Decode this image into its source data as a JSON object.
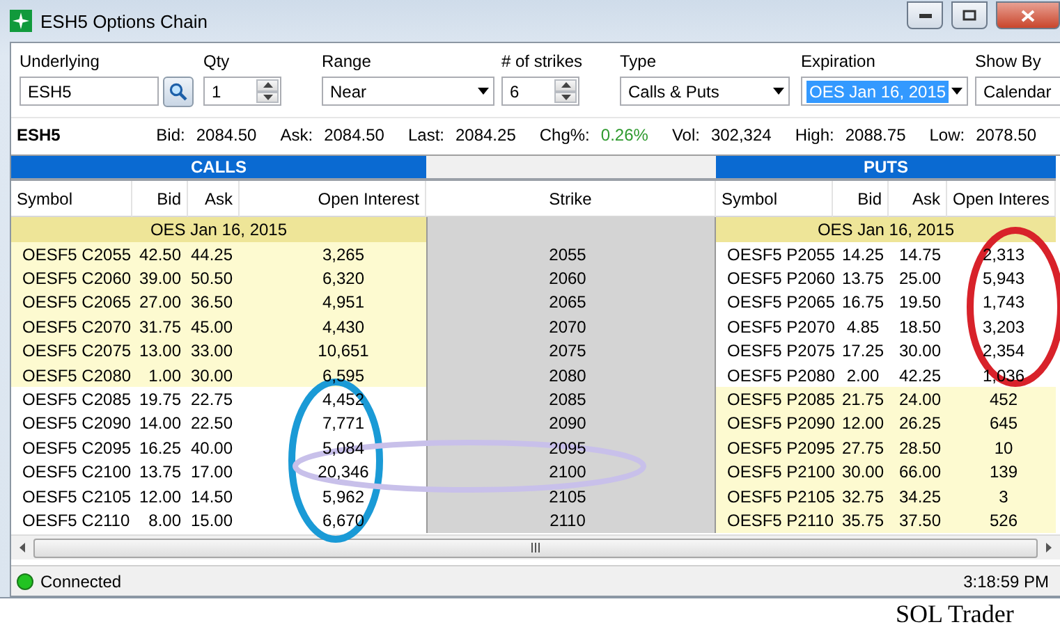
{
  "window": {
    "title": "ESH5 Options Chain"
  },
  "controls": [
    {
      "label": "Underlying",
      "kind": "lookup",
      "value": "ESH5",
      "highlighted": false
    },
    {
      "label": "Qty",
      "kind": "spinner",
      "value": "1",
      "highlighted": false
    },
    {
      "label": "Range",
      "kind": "dropdown",
      "value": "Near",
      "highlighted": false
    },
    {
      "label": "# of strikes",
      "kind": "spinner",
      "value": "6",
      "highlighted": false
    },
    {
      "label": "Type",
      "kind": "dropdown",
      "value": "Calls & Puts",
      "highlighted": false
    },
    {
      "label": "Expiration",
      "kind": "dropdown",
      "value": "OES Jan 16, 2015",
      "highlighted": true
    },
    {
      "label": "Show By",
      "kind": "dropdown",
      "value": "Calendar",
      "highlighted": false
    }
  ],
  "quote": {
    "symbol": "ESH5",
    "fields": [
      {
        "label": "Bid:",
        "value": "2084.50",
        "color": "#000000"
      },
      {
        "label": "Ask:",
        "value": "2084.50",
        "color": "#000000"
      },
      {
        "label": "Last:",
        "value": "2084.25",
        "color": "#000000"
      },
      {
        "label": "Chg%:",
        "value": "0.26%",
        "color": "#2e9a2e"
      },
      {
        "label": "Vol:",
        "value": "302,324",
        "color": "#000000"
      },
      {
        "label": "High:",
        "value": "2088.75",
        "color": "#000000"
      },
      {
        "label": "Low:",
        "value": "2078.50",
        "color": "#000000"
      }
    ]
  },
  "chain": {
    "calls_title": "CALLS",
    "puts_title": "PUTS",
    "call_columns": [
      "Symbol",
      "Bid",
      "Ask",
      "Open Interest"
    ],
    "strike_column": "Strike",
    "put_columns": [
      "Symbol",
      "Bid",
      "Ask",
      "Open Interes"
    ],
    "call_group": "OES Jan 16, 2015",
    "put_group": "OES Jan 16, 2015",
    "rows": [
      {
        "strike": "2055",
        "call": {
          "symbol": "OESF5 C2055",
          "bid": "42.50",
          "ask": "44.25",
          "oi": "3,265",
          "in_the_money": true
        },
        "put": {
          "symbol": "OESF5 P2055",
          "bid": "14.25",
          "ask": "14.75",
          "oi": "2,313",
          "in_the_money": false
        }
      },
      {
        "strike": "2060",
        "call": {
          "symbol": "OESF5 C2060",
          "bid": "39.00",
          "ask": "50.50",
          "oi": "6,320",
          "in_the_money": true
        },
        "put": {
          "symbol": "OESF5 P2060",
          "bid": "13.75",
          "ask": "25.00",
          "oi": "5,943",
          "in_the_money": false
        }
      },
      {
        "strike": "2065",
        "call": {
          "symbol": "OESF5 C2065",
          "bid": "27.00",
          "ask": "36.50",
          "oi": "4,951",
          "in_the_money": true
        },
        "put": {
          "symbol": "OESF5 P2065",
          "bid": "16.75",
          "ask": "19.50",
          "oi": "1,743",
          "in_the_money": false
        }
      },
      {
        "strike": "2070",
        "call": {
          "symbol": "OESF5 C2070",
          "bid": "31.75",
          "ask": "45.00",
          "oi": "4,430",
          "in_the_money": true
        },
        "put": {
          "symbol": "OESF5 P2070",
          "bid": "4.85",
          "ask": "18.50",
          "oi": "3,203",
          "in_the_money": false
        }
      },
      {
        "strike": "2075",
        "call": {
          "symbol": "OESF5 C2075",
          "bid": "13.00",
          "ask": "33.00",
          "oi": "10,651",
          "in_the_money": true
        },
        "put": {
          "symbol": "OESF5 P2075",
          "bid": "17.25",
          "ask": "30.00",
          "oi": "2,354",
          "in_the_money": false
        }
      },
      {
        "strike": "2080",
        "call": {
          "symbol": "OESF5 C2080",
          "bid": "1.00",
          "ask": "30.00",
          "oi": "6,595",
          "in_the_money": true
        },
        "put": {
          "symbol": "OESF5 P2080",
          "bid": "2.00",
          "ask": "42.25",
          "oi": "1,036",
          "in_the_money": false
        }
      },
      {
        "strike": "2085",
        "call": {
          "symbol": "OESF5 C2085",
          "bid": "19.75",
          "ask": "22.75",
          "oi": "4,452",
          "in_the_money": false
        },
        "put": {
          "symbol": "OESF5 P2085",
          "bid": "21.75",
          "ask": "24.00",
          "oi": "452",
          "in_the_money": true
        }
      },
      {
        "strike": "2090",
        "call": {
          "symbol": "OESF5 C2090",
          "bid": "14.00",
          "ask": "22.50",
          "oi": "7,771",
          "in_the_money": false
        },
        "put": {
          "symbol": "OESF5 P2090",
          "bid": "12.00",
          "ask": "26.25",
          "oi": "645",
          "in_the_money": true
        }
      },
      {
        "strike": "2095",
        "call": {
          "symbol": "OESF5 C2095",
          "bid": "16.25",
          "ask": "40.00",
          "oi": "5,084",
          "in_the_money": false
        },
        "put": {
          "symbol": "OESF5 P2095",
          "bid": "27.75",
          "ask": "28.50",
          "oi": "10",
          "in_the_money": true
        }
      },
      {
        "strike": "2100",
        "call": {
          "symbol": "OESF5 C2100",
          "bid": "13.75",
          "ask": "17.00",
          "oi": "20,346",
          "in_the_money": false
        },
        "put": {
          "symbol": "OESF5 P2100",
          "bid": "30.00",
          "ask": "66.00",
          "oi": "139",
          "in_the_money": true
        }
      },
      {
        "strike": "2105",
        "call": {
          "symbol": "OESF5 C2105",
          "bid": "12.00",
          "ask": "14.50",
          "oi": "5,962",
          "in_the_money": false
        },
        "put": {
          "symbol": "OESF5 P2105",
          "bid": "32.75",
          "ask": "34.25",
          "oi": "3",
          "in_the_money": true
        }
      },
      {
        "strike": "2110",
        "call": {
          "symbol": "OESF5 C2110",
          "bid": "8.00",
          "ask": "15.00",
          "oi": "6,670",
          "in_the_money": false
        },
        "put": {
          "symbol": "OESF5 P2110",
          "bid": "35.75",
          "ask": "37.50",
          "oi": "526",
          "in_the_money": true
        }
      }
    ]
  },
  "status_bar": {
    "connected": true,
    "text": "Connected",
    "time": "3:18:59 PM"
  },
  "annotations": [
    {
      "kind": "ellipse",
      "color": "#1a9ad6"
    },
    {
      "kind": "ellipse",
      "color": "#c8c0ea"
    },
    {
      "kind": "ellipse",
      "color": "#d8222a"
    }
  ],
  "caption": "SOL Trader"
}
